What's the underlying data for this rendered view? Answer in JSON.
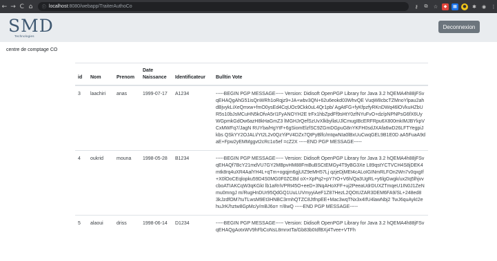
{
  "browser": {
    "url_host": "localhost",
    "url_path": ":8080/webapp/TraiterAuthoCo",
    "back_glyph": "←",
    "forward_glyph": "→",
    "reload_glyph": "C",
    "home_glyph": "⌂",
    "lock_glyph": "ⓘ",
    "extension_icons": [
      "key-icon",
      "translate-icon",
      "star-icon",
      "extension-red-icon",
      "extension-blue-icon",
      "extension-yellow-icon",
      "puzzle-icon",
      "profile-icon",
      "menu-icon"
    ]
  },
  "header": {
    "logo_text": "SMD",
    "logo_subtitle": "Technologies",
    "logout_label": "Deconnexion"
  },
  "page": {
    "subtitle": "centre de comptage CO"
  },
  "table": {
    "columns": [
      "id",
      "Nom",
      "Prenom",
      "Date Naissance",
      "Identificateur",
      "Bulltin Vote"
    ],
    "rows": [
      {
        "id": "3",
        "nom": "laachiri",
        "prenom": "anas",
        "date": "1999-07-17",
        "identificateur": "A1234",
        "vote": "-----BEGIN PGP MESSAGE----- Version: Didisoft OpenPGP Library for Java 3.2 hQEMA4h88jFSvqEHAQgAhG51isQnWRh1oRqjz9+JA+wbv3QN+62u6eokd03WhvQE VuqW8cbcTZMnoYlpau2ahdBjvykLiXeQmxw+fmO0ysEd4CqUOc9Ckk0uL4Qr1pb/ AgAtFG+fyKfpzfyRKnDWq46lOVkuHZbUR5s10bJsMCuHN5kOfvA5rI1FyANOYH2E trFx1hbZpdFf9sHtY0zfNYuFvO+dz/pNPNPsG6fX6UyWGpmkGdOw6azH8kHaGmZ3 lMGHJrQefSzUvXlkbyllaUJlCmugIBcERFRpu6X800mkIMJBYkpVCxMWFq7/JagN RUYba/HgYtF+6gSiomElzfSC9ZGmDGpuG8nYKFH0sdJXAfa6wD26LFTYegpiJkbs QSkYY2OJALI/Yt2L2v0QzYiPV4DZx7QtPyBlfc/mtqwNIa0lBxUuCwqGEL9B1E0D aA5FuaA9daE+Fpw2yEMMggvt2cRc1o5ef =cZ2X -----END PGP MESSAGE-----"
      },
      {
        "id": "4",
        "nom": "oukrid",
        "prenom": "mouna",
        "date": "1998-05-28",
        "identificateur": "B1234",
        "vote": "-----BEGIN PGP MESSAGE----- Version: Didisoft OpenPGP Library for Java 3.2 hQEMA4h88jFSvqEHAQf7BcY21mdVU7GY2MBpvHM88FmBuBSCtEMGy4T9yBG3Xe L89qstYCTVCH4S8jDEK4mtk8rq4uXR4AalYH4L+qTm+ogqjm6gjUIZ9eMH57Lj qzjeDjMEt4cALoIGINmRLFOn2Wn7v0qxgIf+X0lOoCEqlopku59D4S0MG0F0ZCBd oX+XpPq2+pY7rO+V6h/Qa3UgRL+y6lgGwgk/ux2Iq5lhjvvcboATIAKCqW3qKGkI lb1aRriVPRt45O+eeD+3NqAHoXFF+uj2PeeaUdrDUXZTmqeU1IN0J1ZeNmu0mngJ m/RugHnDUr95QdGQ1UuLUVmyyiAeF1Z87HezL2QOtUZAR3DEM6FA9/SL+248ed8 3kJzdfOM7tuTLwsM9Et3HNBC3rmhQTZC8JtfnpEE+Mac3wqTNx3x4IfU4lawNbj2 TwJ6quAykI2ehuJrK/hztw8GpMc/y/mBJ6o= =/8wQ -----END PGP MESSAGE-----"
      },
      {
        "id": "5",
        "nom": "alaoui",
        "prenom": "driss",
        "date": "1998-06-14",
        "identificateur": "D1234",
        "vote": "-----BEGIN PGP MESSAGE----- Version: Didisoft OpenPGP Library for Java 3.2 hQEMA4h88jFSvqEHAQgAotxWV9hFbCoNsL8mnxtTa/Gb83b0IdfBXj4Tvee+VTFh"
      }
    ]
  }
}
